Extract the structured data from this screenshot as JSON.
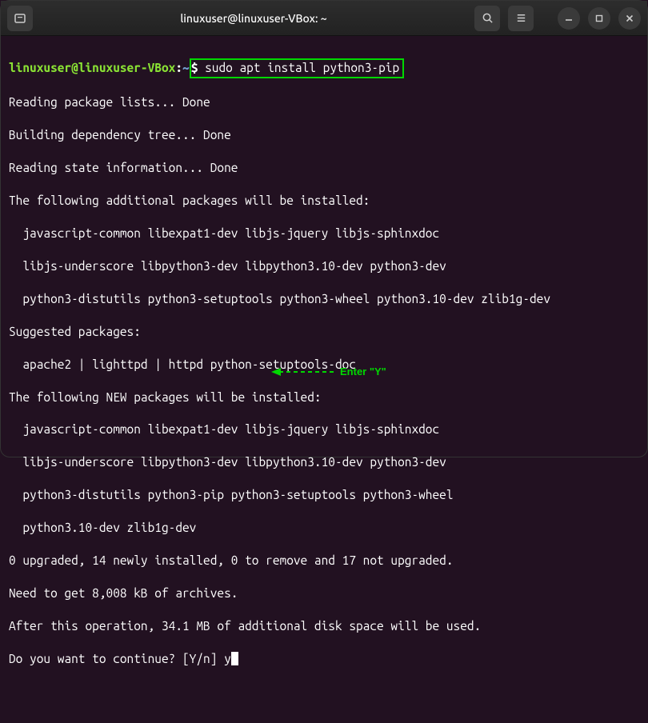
{
  "titlebar": {
    "title": "linuxuser@linuxuser-VBox: ~"
  },
  "prompt": {
    "user_host": "linuxuser@linuxuser-VBox",
    "colon": ":",
    "path": "~",
    "dollar": "$ ",
    "command": "sudo apt install python3-pip"
  },
  "output": {
    "l1": "Reading package lists... Done",
    "l2": "Building dependency tree... Done",
    "l3": "Reading state information... Done",
    "l4": "The following additional packages will be installed:",
    "l5": "  javascript-common libexpat1-dev libjs-jquery libjs-sphinxdoc",
    "l6": "  libjs-underscore libpython3-dev libpython3.10-dev python3-dev",
    "l7": "  python3-distutils python3-setuptools python3-wheel python3.10-dev zlib1g-dev",
    "l8": "Suggested packages:",
    "l9": "  apache2 | lighttpd | httpd python-setuptools-doc",
    "l10": "The following NEW packages will be installed:",
    "l11": "  javascript-common libexpat1-dev libjs-jquery libjs-sphinxdoc",
    "l12": "  libjs-underscore libpython3-dev libpython3.10-dev python3-dev",
    "l13": "  python3-distutils python3-pip python3-setuptools python3-wheel",
    "l14": "  python3.10-dev zlib1g-dev",
    "l15": "0 upgraded, 14 newly installed, 0 to remove and 17 not upgraded.",
    "l16": "Need to get 8,008 kB of archives.",
    "l17": "After this operation, 34.1 MB of additional disk space will be used.",
    "l18": "Do you want to continue? [Y/n] y"
  },
  "annotation": {
    "text": "Enter \"Y\""
  }
}
